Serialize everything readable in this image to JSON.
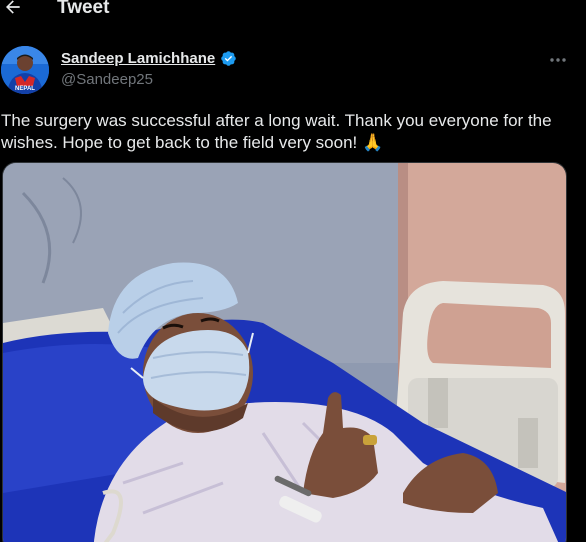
{
  "header": {
    "back_icon": "arrow-left-icon",
    "title": "Tweet"
  },
  "author": {
    "display_name": "Sandeep Lamichhane",
    "handle": "@Sandeep25",
    "verified_icon": "verified-badge-icon",
    "avatar_jersey_text": "NEPAL",
    "more_icon": "more-horizontal-icon"
  },
  "tweet": {
    "text": "The surgery was successful after a long wait. Thank you everyone for the wishes. Hope to get back to the field very soon!",
    "emoji": "🙏"
  },
  "media": {
    "description_icon": "photo-patient-hospital-bed"
  },
  "colors": {
    "background": "#000000",
    "text": "#e7e9ea",
    "secondary": "#71767b",
    "verified": "#1d9bf0"
  }
}
